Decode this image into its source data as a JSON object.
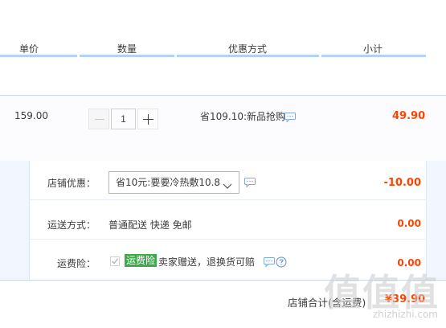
{
  "header": {
    "col_price": "单价",
    "col_qty": "数量",
    "col_promo": "优惠方式",
    "col_subtotal": "小计"
  },
  "item": {
    "unit_price": "159.00",
    "quantity": "1",
    "promo": "省109.10:新品抢购",
    "subtotal": "49.90"
  },
  "shop": {
    "discount_label": "店铺优惠：",
    "discount_selected": "省10元:要要冷热敷10.8",
    "discount_value": "-10.00",
    "shipping_label": "运送方式：",
    "shipping_value": "普通配送 快递 免邮",
    "shipping_fee": "0.00",
    "insurance_label": "运费险：",
    "insurance_tag": "运费险",
    "insurance_text": "卖家赠送，退换货可赔",
    "insurance_fee": "0.00"
  },
  "total": {
    "label": "店铺合计(含运费)",
    "value": "¥39.90"
  },
  "watermark": {
    "logo": "值值值",
    "url": "zhizhizhi.com"
  },
  "colors": {
    "accent_price": "#ff4400",
    "header_line": "#b2d1ff",
    "insurance_tag": "#3dab4a"
  }
}
